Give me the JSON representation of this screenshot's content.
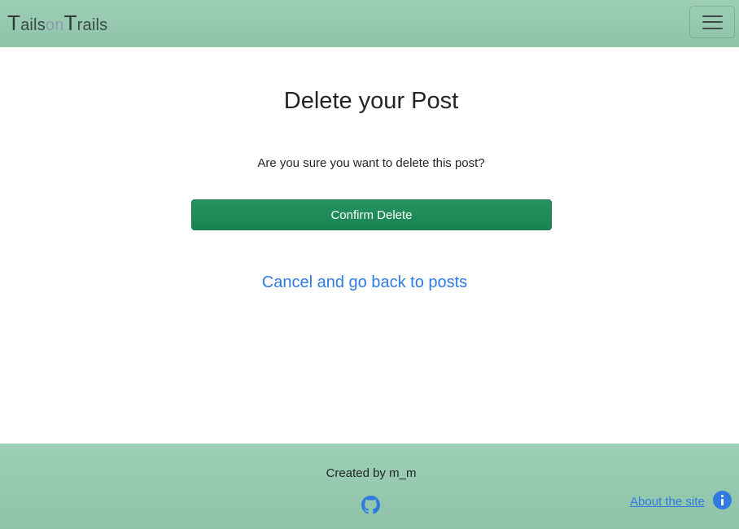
{
  "navbar": {
    "brand": {
      "t1": "T",
      "part1": "ails",
      "on": "on",
      "t2": "T",
      "part2": "rails"
    },
    "menu_icon": "hamburger-icon"
  },
  "main": {
    "title": "Delete your Post",
    "question": "Are you sure you want to delete this post?",
    "confirm_label": "Confirm Delete",
    "cancel_label": "Cancel and go back to posts"
  },
  "footer": {
    "created_by": "Created by m_m",
    "github_icon": "github-icon",
    "about_label": "About the site",
    "info_icon": "info-circle-icon"
  },
  "colors": {
    "header_footer_bg": "#9dcfb6",
    "confirm_button": "#1f8a56",
    "link": "#2f7be0"
  }
}
